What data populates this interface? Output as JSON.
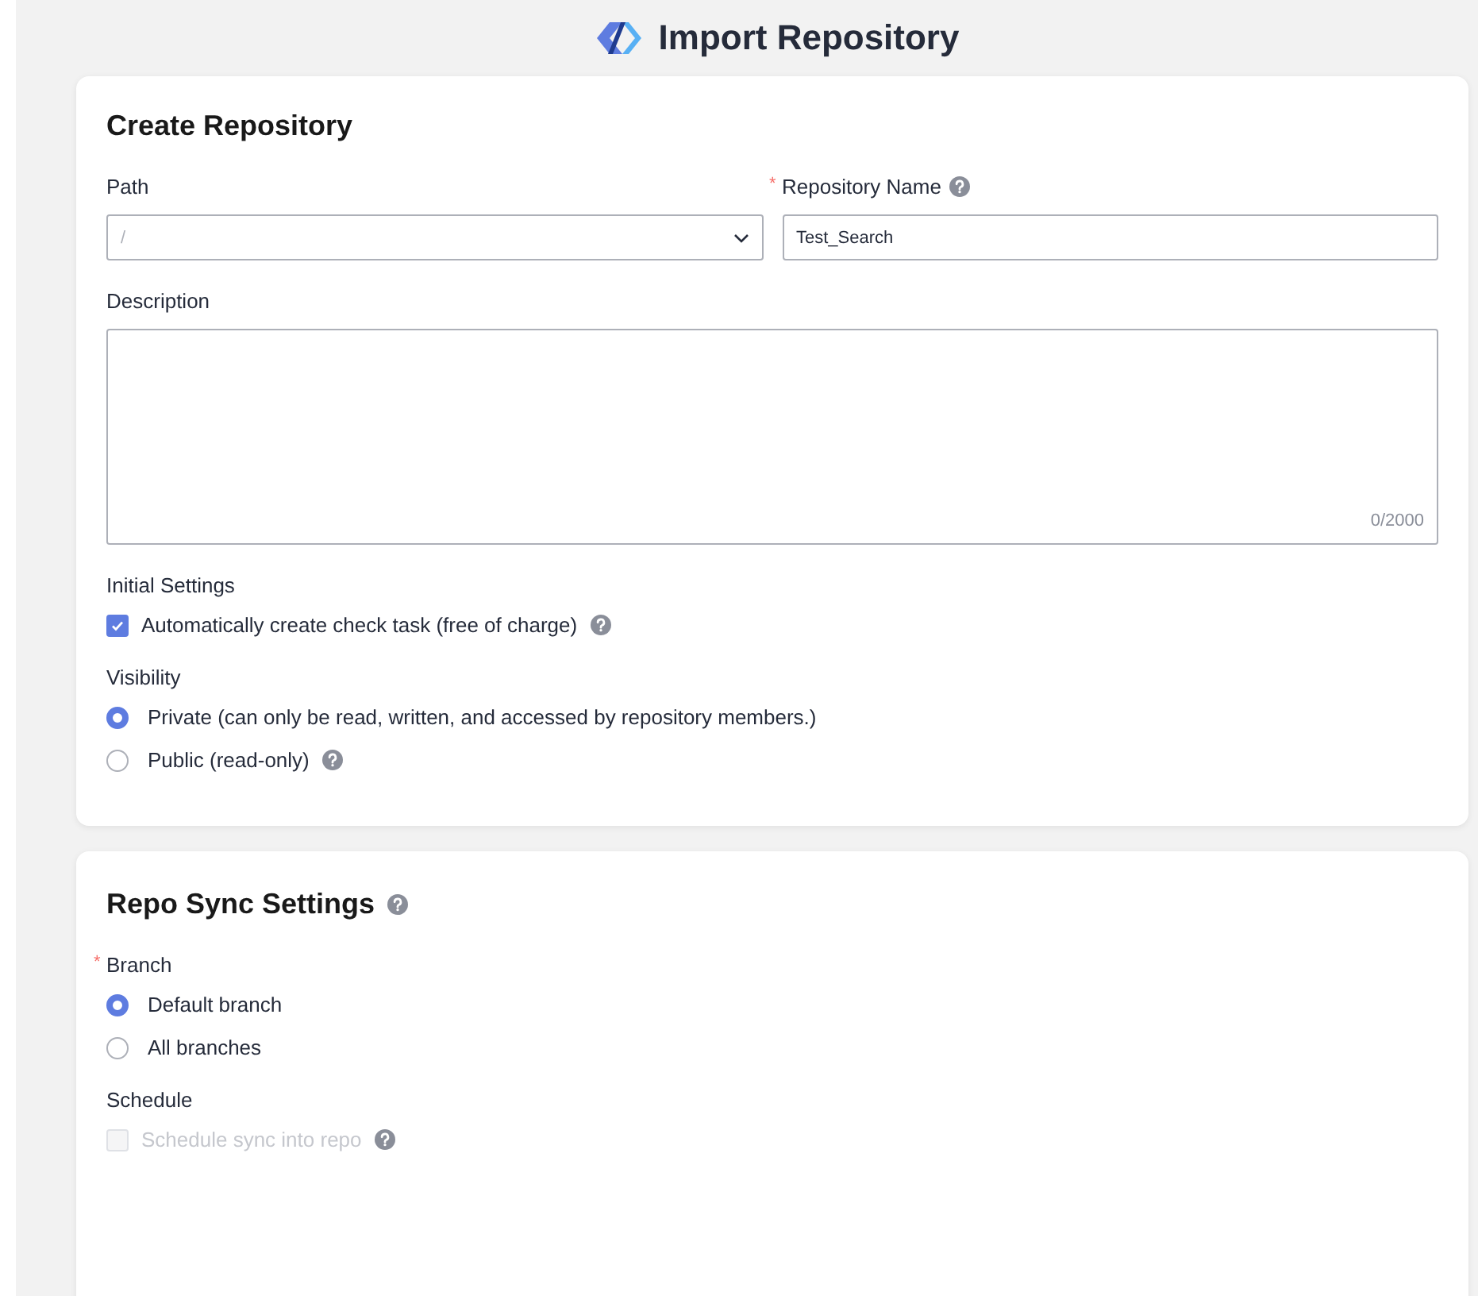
{
  "title": "Import Repository",
  "create": {
    "heading": "Create Repository",
    "path": {
      "label": "Path",
      "placeholder": "/"
    },
    "name": {
      "label": "Repository Name",
      "required_mark": "*",
      "help": true,
      "value": "Test_Search"
    },
    "description": {
      "label": "Description",
      "counter": "0/2000"
    },
    "initial_settings": {
      "label": "Initial Settings",
      "options": [
        {
          "kind": "checkbox",
          "label": "Automatically create check task (free of charge)",
          "checked": true,
          "disabled": false,
          "help": true
        }
      ]
    },
    "visibility": {
      "label": "Visibility",
      "options": [
        {
          "kind": "radio",
          "label": "Private (can only be read, written, and accessed by repository members.)",
          "selected": true,
          "help": false
        },
        {
          "kind": "radio",
          "label": "Public (read-only)",
          "selected": false,
          "help": true
        }
      ]
    }
  },
  "sync": {
    "heading": "Repo Sync Settings",
    "help": true,
    "branch": {
      "label": "Branch",
      "required_mark": "*",
      "options": [
        {
          "kind": "radio",
          "label": "Default branch",
          "selected": true,
          "help": false
        },
        {
          "kind": "radio",
          "label": "All branches",
          "selected": false,
          "help": false
        }
      ]
    },
    "schedule": {
      "label": "Schedule",
      "options": [
        {
          "kind": "checkbox",
          "label": "Schedule sync into repo",
          "checked": false,
          "disabled": true,
          "help": true
        }
      ]
    }
  }
}
